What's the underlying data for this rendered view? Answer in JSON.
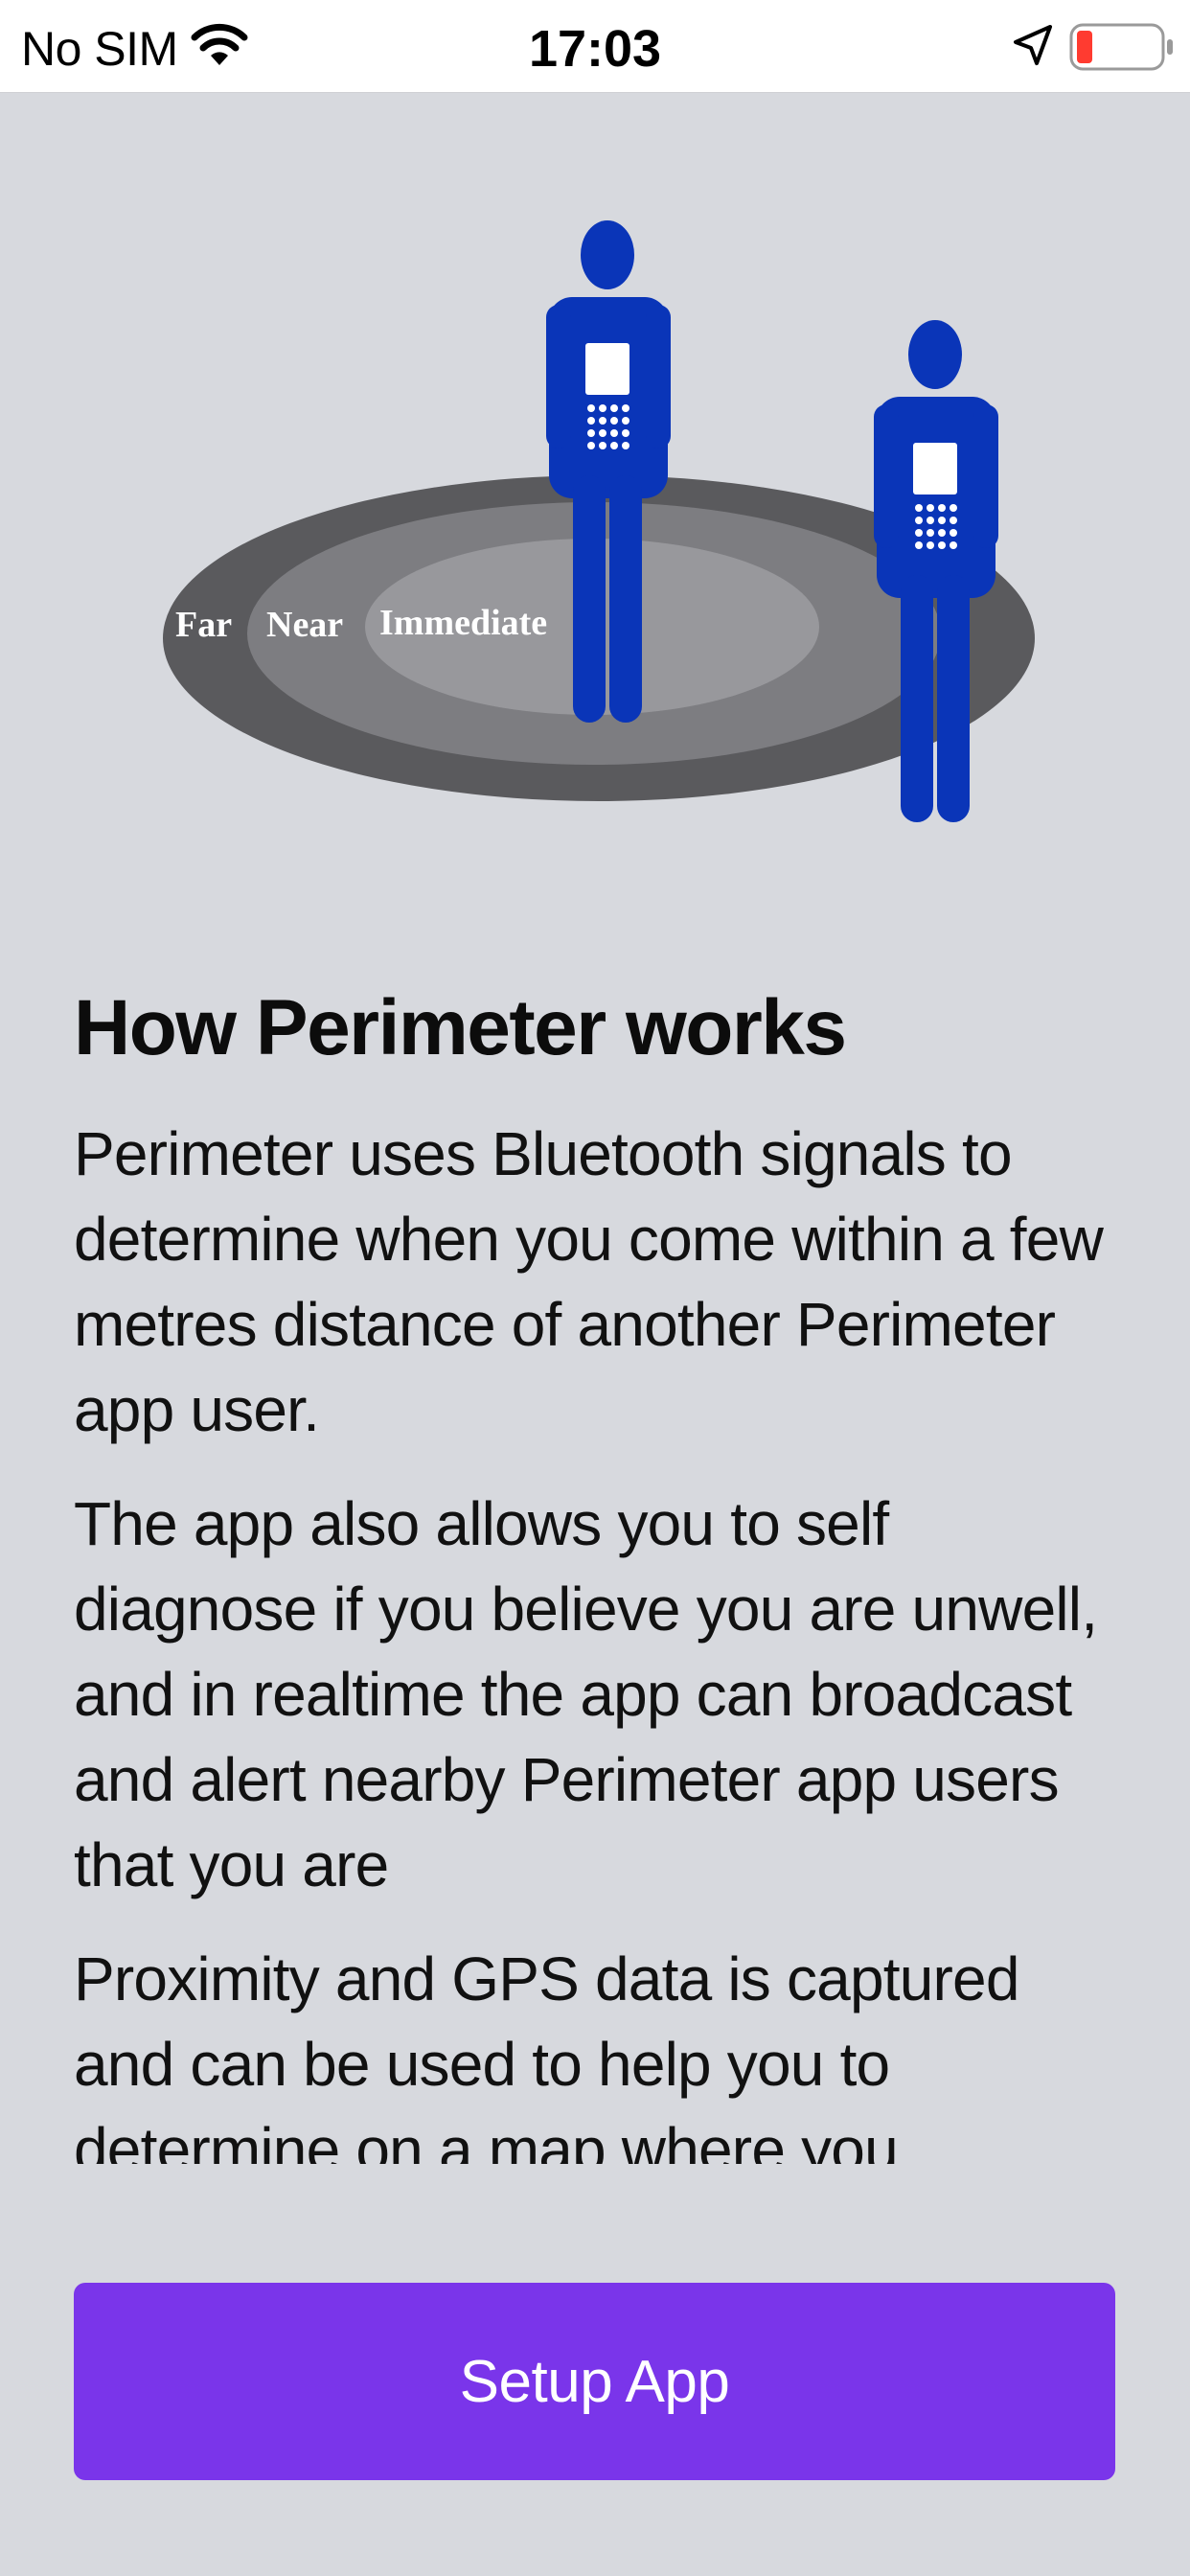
{
  "status_bar": {
    "carrier": "No SIM",
    "time": "17:03",
    "icons": [
      "wifi-icon",
      "location-arrow-icon",
      "battery-low-icon"
    ],
    "battery_color": "#ff3b30"
  },
  "hero": {
    "zone_labels": [
      "Far",
      "Near",
      "Immediate"
    ],
    "figure_color": "#0a35b8"
  },
  "content": {
    "title": "How Perimeter works",
    "paragraphs": [
      "Perimeter uses Bluetooth signals to determine when you come within a few metres distance of another Perimeter app user.",
      "The app also allows you to self diagnose if you believe you are unwell, and in realtime the app can broadcast and alert nearby Perimeter app users that you are",
      "Proximity and GPS data is captured and can be used to help you to determine on a map where you"
    ]
  },
  "actions": {
    "setup_label": "Setup App",
    "accent_color": "#7a35ea"
  }
}
